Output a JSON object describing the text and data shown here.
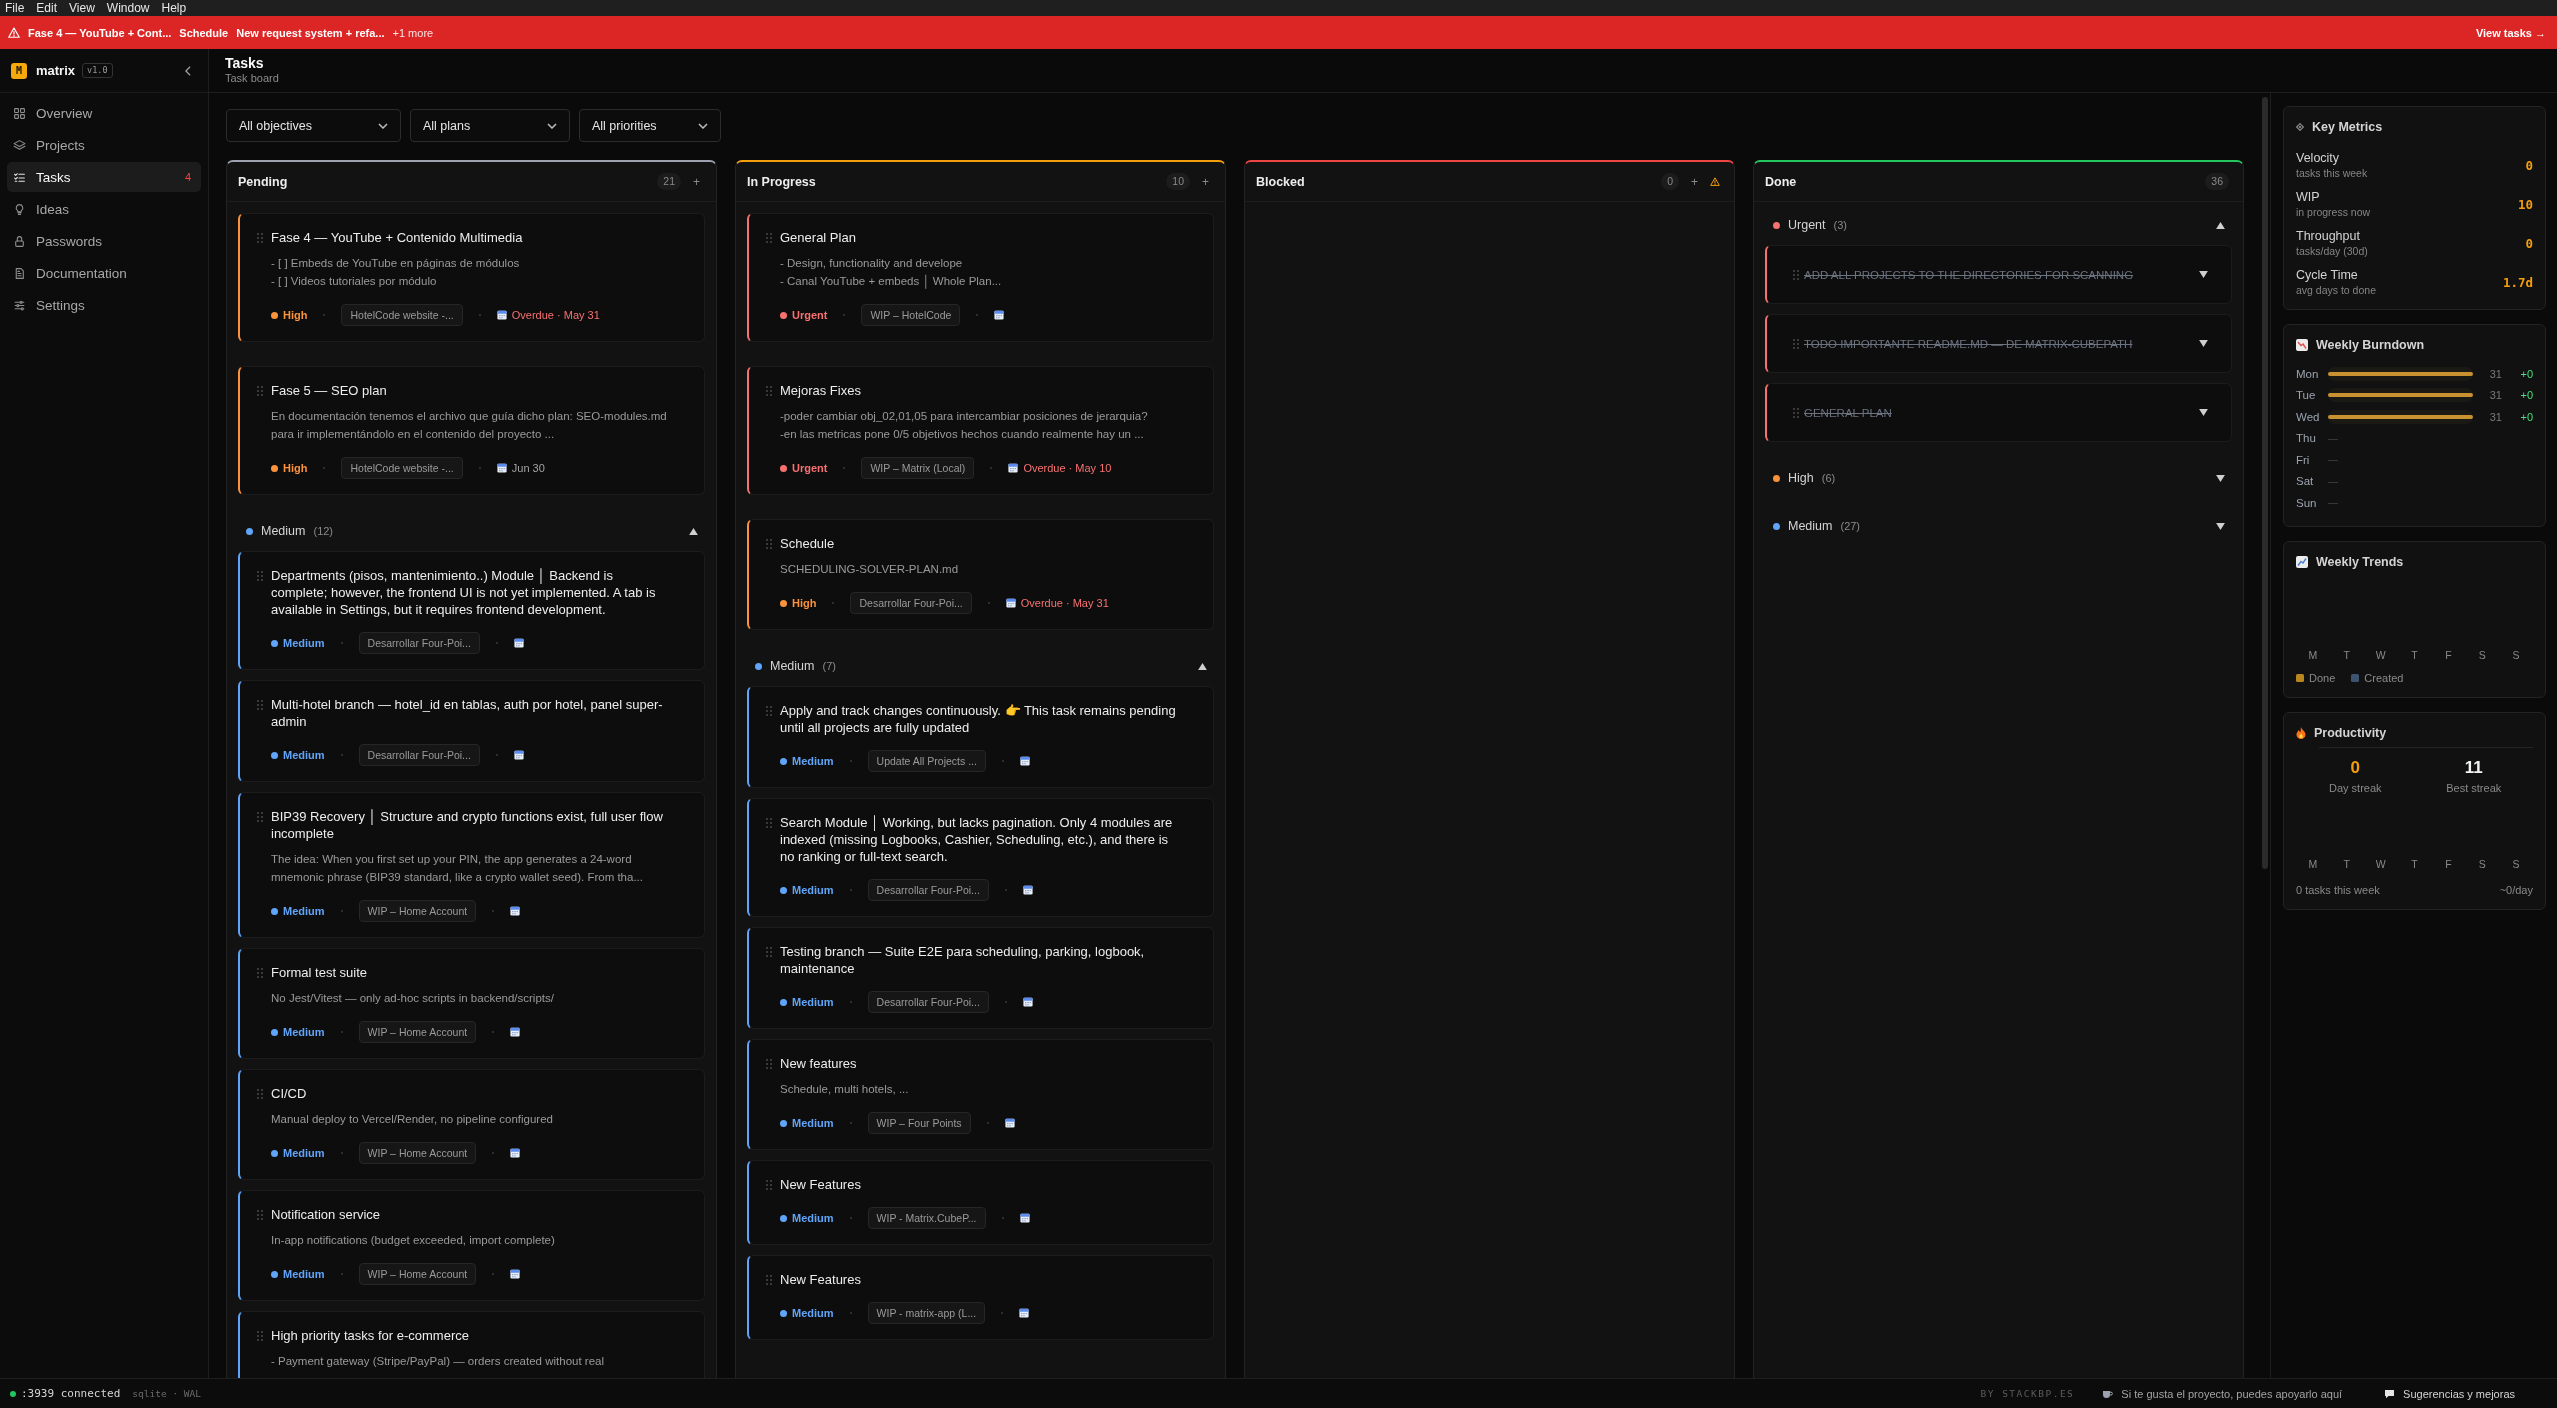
{
  "menu_bar": [
    "File",
    "Edit",
    "View",
    "Window",
    "Help"
  ],
  "banner": {
    "tasks": [
      "Fase 4 — YouTube + Cont...",
      "Schedule",
      "New request system + refa..."
    ],
    "more": "+1 more",
    "action": "View tasks →"
  },
  "sidebar": {
    "logo_mark": "M",
    "app_name": "matrix",
    "version": "v1.0",
    "items": [
      {
        "label": "Overview",
        "selected": false
      },
      {
        "label": "Projects",
        "selected": false
      },
      {
        "label": "Tasks",
        "selected": true,
        "badge": "4"
      },
      {
        "label": "Ideas",
        "selected": false
      },
      {
        "label": "Passwords",
        "selected": false
      },
      {
        "label": "Documentation",
        "selected": false
      },
      {
        "label": "Settings",
        "selected": false
      }
    ]
  },
  "page": {
    "title": "Tasks",
    "subtitle": "Task board"
  },
  "filters": [
    {
      "value": "All objectives"
    },
    {
      "value": "All plans"
    },
    {
      "value": "All priorities"
    }
  ],
  "columns": [
    {
      "title": "Pending",
      "count": "21",
      "color": "#9ca3af",
      "add": "+",
      "cards": [
        {
          "title": "Fase 4 — YouTube + Contenido Multimedia",
          "description": [
            "- [ ] Embeds de YouTube en páginas de módulos",
            "- [ ] Videos tutoriales por módulo"
          ],
          "priority": "High",
          "color": "#fb923c",
          "project": "HotelCode website -...",
          "due": "Overdue · May 31",
          "overdue": true
        },
        {
          "title": "Fase 5 — SEO plan",
          "description": [
            "En documentación tenemos el archivo que guía dicho plan: SEO-modules.md para ir implementándolo en el contenido del proyecto ..."
          ],
          "priority": "High",
          "color": "#fb923c",
          "project": "HotelCode website -...",
          "due": "Jun 30",
          "overdue": false
        }
      ],
      "groups": [
        {
          "label": "Medium",
          "count": "(12)",
          "color": "#60a5fa",
          "expanded": true,
          "cards": [
            {
              "title": "Departments (pisos, mantenimiento..) Module │ Backend is complete; however, the frontend UI is not yet implemented. A tab is available in Settings, but it requires frontend development.",
              "priority": "Medium",
              "color": "#60a5fa",
              "project": "Desarrollar Four-Poi..."
            },
            {
              "title": "Multi-hotel branch — hotel_id en tablas, auth por hotel, panel super-admin",
              "priority": "Medium",
              "color": "#60a5fa",
              "project": "Desarrollar Four-Poi..."
            },
            {
              "title": "BIP39 Recovery │ Structure and crypto functions exist, full user flow incomplete",
              "description": [
                "The idea: When you first set up your PIN, the app generates a 24-word mnemonic phrase (BIP39 standard, like a crypto wallet seed). From tha..."
              ],
              "priority": "Medium",
              "color": "#60a5fa",
              "project": "WIP – Home Account"
            },
            {
              "title": "Formal test suite",
              "description": [
                "No Jest/Vitest — only ad-hoc scripts in backend/scripts/"
              ],
              "priority": "Medium",
              "color": "#60a5fa",
              "project": "WIP – Home Account"
            },
            {
              "title": "CI/CD",
              "description": [
                "Manual deploy to Vercel/Render, no pipeline configured"
              ],
              "priority": "Medium",
              "color": "#60a5fa",
              "project": "WIP – Home Account"
            },
            {
              "title": "Notification service",
              "description": [
                "In-app notifications (budget exceeded, import complete)"
              ],
              "priority": "Medium",
              "color": "#60a5fa",
              "project": "WIP – Home Account"
            },
            {
              "title": "High priority tasks for e-commerce",
              "description": [
                "- Payment gateway (Stripe/PayPal) — orders created without real"
              ]
            }
          ]
        }
      ]
    },
    {
      "title": "In Progress",
      "count": "10",
      "color": "#f59e0b",
      "add": "+",
      "cards": [
        {
          "title": "General Plan",
          "description": [
            "- Design, functionality and develope",
            "- Canal YouTube + embeds │ Whole Plan..."
          ],
          "priority": "Urgent",
          "color": "#f87171",
          "project": "WIP – HotelCode"
        },
        {
          "title": "Mejoras Fixes",
          "description": [
            "-poder cambiar obj_02,01,05 para intercambiar posiciones de jerarquia?",
            "-en las metricas pone 0/5 objetivos hechos cuando realmente hay un ..."
          ],
          "priority": "Urgent",
          "color": "#f87171",
          "project": "WIP – Matrix (Local)",
          "due": "Overdue · May 10",
          "overdue": true
        },
        {
          "title": "Schedule",
          "description": [
            "SCHEDULING-SOLVER-PLAN.md"
          ],
          "priority": "High",
          "color": "#fb923c",
          "project": "Desarrollar Four-Poi...",
          "due": "Overdue · May 31",
          "overdue": true
        }
      ],
      "groups": [
        {
          "label": "Medium",
          "count": "(7)",
          "color": "#60a5fa",
          "expanded": true,
          "cards": [
            {
              "title": "Apply and track changes continuously. 👉 This task remains pending until all projects are fully updated",
              "priority": "Medium",
              "color": "#60a5fa",
              "project": "Update All Projects ..."
            },
            {
              "title": "Search Module │ Working, but lacks pagination. Only 4 modules are indexed (missing Logbooks, Cashier, Scheduling, etc.), and there is no ranking or full-text search.",
              "priority": "Medium",
              "color": "#60a5fa",
              "project": "Desarrollar Four-Poi..."
            },
            {
              "title": "Testing branch — Suite E2E para scheduling, parking, logbook, maintenance",
              "priority": "Medium",
              "color": "#60a5fa",
              "project": "Desarrollar Four-Poi..."
            },
            {
              "title": "New features",
              "description": [
                "Schedule, multi hotels, ..."
              ],
              "priority": "Medium",
              "color": "#60a5fa",
              "project": "WIP – Four Points"
            },
            {
              "title": "New Features",
              "priority": "Medium",
              "color": "#60a5fa",
              "project": "WIP - Matrix.CubeP..."
            },
            {
              "title": "New Features",
              "priority": "Medium",
              "color": "#60a5fa",
              "project": "WIP - matrix-app (L..."
            }
          ]
        }
      ]
    },
    {
      "title": "Blocked",
      "count": "0",
      "color": "#ef4444",
      "add": "+",
      "alert": true
    },
    {
      "title": "Done",
      "count": "36",
      "color": "#22c55e",
      "groups": [
        {
          "label": "Urgent",
          "count": "(3)",
          "color": "#f87171",
          "expanded": true,
          "done_cards": [
            {
              "title": "ADD ALL PROJECTS TO THE DIRECTORIES FOR SCANNING",
              "done": true,
              "expanded": false
            },
            {
              "title": "TODO IMPORTANTE README.MD — DE MATRIX-CUBEPATH",
              "done": true,
              "expanded": false
            },
            {
              "title": "GENERAL PLAN",
              "done": true,
              "expanded": false
            }
          ]
        },
        {
          "label": "High",
          "count": "(6)",
          "color": "#fb923c",
          "expanded": false
        },
        {
          "label": "Medium",
          "count": "(27)",
          "color": "#60a5fa",
          "expanded": false
        }
      ]
    }
  ],
  "key_metrics": {
    "title": "Key Metrics",
    "rows": [
      {
        "label": "Velocity",
        "caption": "tasks this week",
        "value": "0"
      },
      {
        "label": "WIP",
        "caption": "in progress now",
        "value": "10"
      },
      {
        "label": "Throughput",
        "caption": "tasks/day (30d)",
        "value": "0"
      },
      {
        "label": "Cycle Time",
        "caption": "avg days to done",
        "value": "1.7d"
      }
    ]
  },
  "burndown": {
    "title": "Weekly Burndown",
    "days": [
      {
        "kind": "bar",
        "day": "Mon",
        "level": 1,
        "count": "31",
        "delta": "+0"
      },
      {
        "kind": "bar",
        "day": "Tue",
        "level": 1,
        "count": "31",
        "delta": "+0"
      },
      {
        "kind": "bar",
        "day": "Wed",
        "level": 1,
        "count": "31",
        "delta": "+0"
      },
      {
        "kind": "empty",
        "day": "Thu",
        "mark": "—"
      },
      {
        "kind": "empty",
        "day": "Fri",
        "mark": "—"
      },
      {
        "kind": "empty",
        "day": "Sat",
        "mark": "—"
      },
      {
        "kind": "empty",
        "day": "Sun",
        "mark": "—"
      }
    ]
  },
  "trends": {
    "title": "Weekly Trends",
    "days": [
      "M",
      "T",
      "W",
      "T",
      "F",
      "S",
      "S"
    ],
    "legend": [
      {
        "label": "Done",
        "color": "#b7861f"
      },
      {
        "label": "Created",
        "color": "#3d5470"
      }
    ]
  },
  "productivity": {
    "title": "Productivity",
    "streaks": [
      {
        "value": "0",
        "label": "Day streak",
        "color": "#f59e0b"
      },
      {
        "value": "11",
        "label": "Best streak",
        "color": "#f3f4f6"
      }
    ],
    "days": [
      "M",
      "T",
      "W",
      "T",
      "F",
      "S",
      "S"
    ],
    "summary": "0 tasks this week",
    "rate": "~0/day"
  },
  "status_bar": {
    "connected": true,
    "connection": ":3939 connected",
    "database": "sqlite · WAL",
    "credit": "BY STACKBP.ES",
    "support": "Si te gusta el proyecto, puedes apoyarlo aquí",
    "feedback": "Sugerencias y mejoras"
  }
}
